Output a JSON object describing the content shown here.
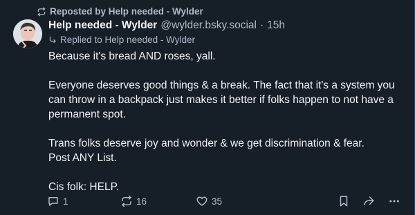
{
  "repost": {
    "label": "Reposted by Help needed - Wylder",
    "icon": "repost-icon"
  },
  "post": {
    "display_name": "Help needed - Wylder",
    "handle": "@wylder.bsky.social",
    "separator": "·",
    "timestamp": "15h",
    "reply_context": "Replied to Help needed - Wylder",
    "paragraphs": [
      "Because it's bread AND roses, yall.",
      "Everyone deserves good things & a break. The fact that it's a system you can throw in a backpack just makes it better if folks happen to not have a permanent spot.",
      "Trans folks deserve joy and wonder & we get discrimination & fear.\nPost ANY List.",
      "Cis folk: HELP."
    ]
  },
  "actions": {
    "replies": "1",
    "reposts": "16",
    "likes": "35"
  },
  "colors": {
    "background": "#161e27",
    "text": "#f1f3f5",
    "muted": "#aebbc9"
  }
}
